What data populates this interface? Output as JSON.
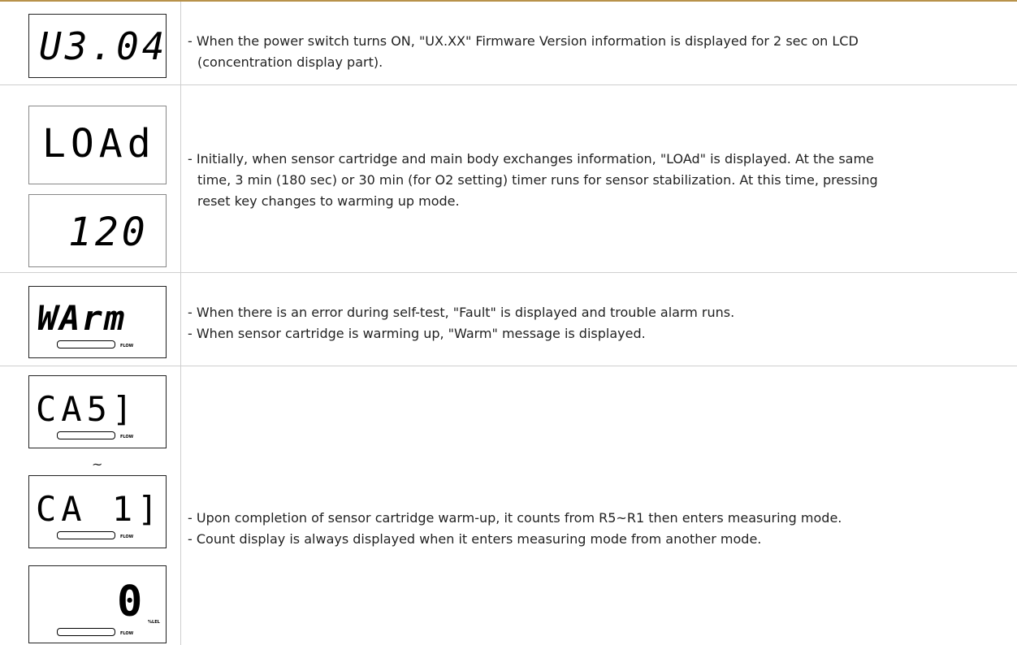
{
  "rows": [
    {
      "displays": [
        "U3.04"
      ],
      "lines": [
        "- When the power switch turns ON, \"UX.XX\" Firmware Version information is displayed for 2 sec on LCD",
        "(concentration display part)."
      ]
    },
    {
      "displays": [
        "LOAd",
        "120"
      ],
      "lines": [
        "- Initially, when sensor cartridge and main body exchanges information, \"LOAd\" is displayed. At the same",
        "time, 3 min (180 sec) or 30 min (for O2 setting) timer runs for sensor stabilization. At this time, pressing",
        "reset key changes to warming up mode."
      ]
    },
    {
      "displays": [
        "WArm"
      ],
      "flow_label": "FLOW",
      "lines": [
        "- When there is an error during self-test, \"Fault\" is displayed and trouble alarm runs.",
        "- When sensor cartridge is warming up, \"Warm\" message is displayed."
      ]
    },
    {
      "displays": [
        "CA5]",
        "CA 1]",
        "0"
      ],
      "separator": "~",
      "flow_label": "FLOW",
      "unit_label": "%LEL",
      "lines": [
        "- Upon completion of sensor cartridge warm-up, it counts from R5~R1 then enters measuring mode.",
        "- Count display is always displayed when it enters measuring mode from another mode."
      ]
    }
  ]
}
